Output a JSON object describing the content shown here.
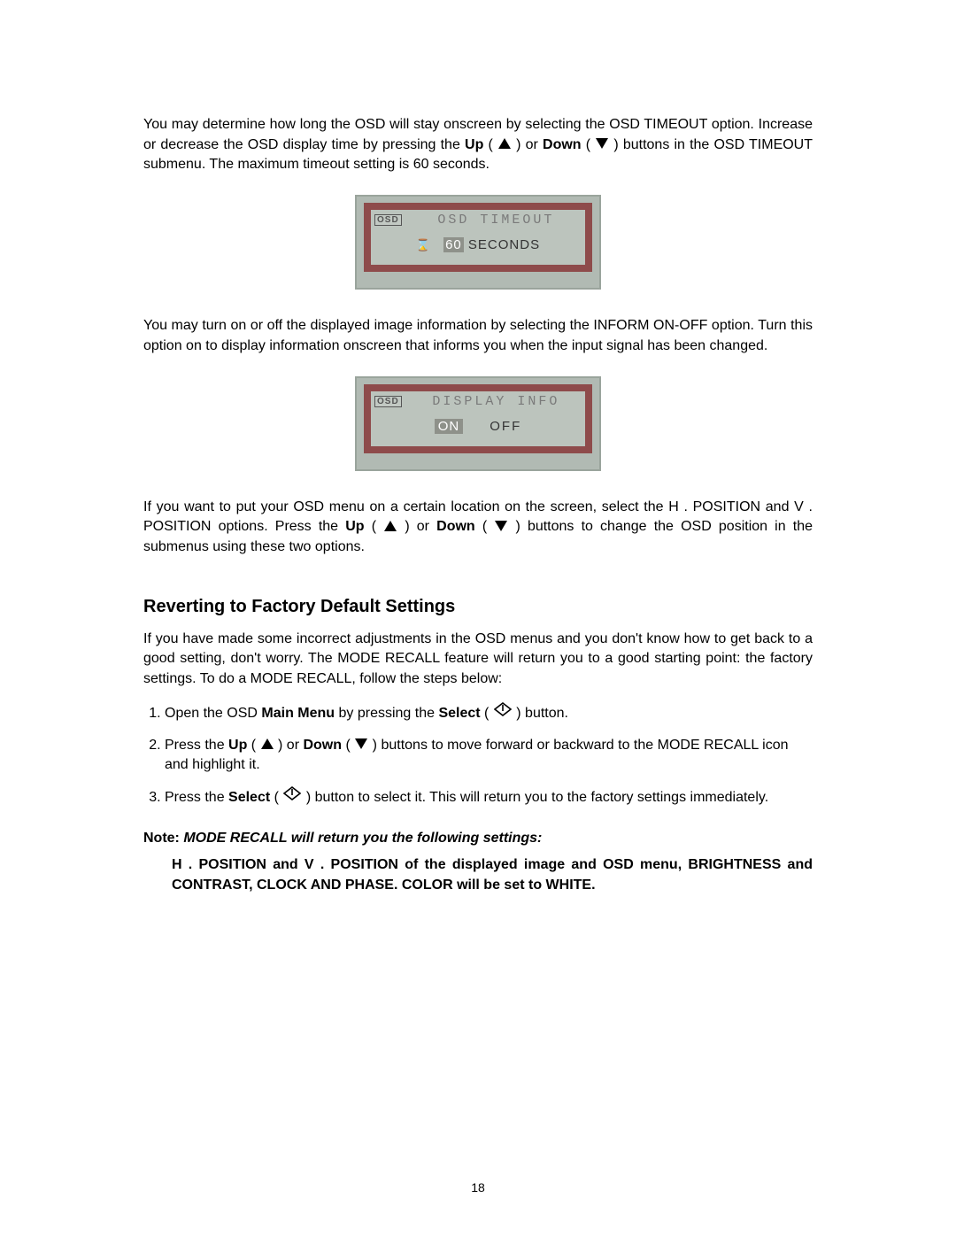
{
  "para1": {
    "a": "You may determine how long the OSD will stay onscreen by selecting the OSD TIMEOUT option. Increase or decrease the OSD display time by pressing the ",
    "b": "Up",
    "c": " ( ",
    "d": " ) or ",
    "e": "Down",
    "f": " ( ",
    "g": " ) buttons in the OSD TIMEOUT submenu. The maximum timeout setting is 60 seconds."
  },
  "osd1": {
    "badge": "OSD",
    "title": "OSD TIMEOUT",
    "value_hl": "60",
    "value_unit": "SECONDS"
  },
  "para2": "You may turn on or off the displayed image information by selecting the INFORM ON-OFF option. Turn this option on to display information onscreen that informs you when the input signal has been changed.",
  "osd2": {
    "badge": "OSD",
    "title": "DISPLAY INFO",
    "on": "ON",
    "off": "OFF"
  },
  "para3": {
    "a": "If you want to put your OSD menu on a certain location on the screen, select the H . POSITION and V . POSITION options. Press the ",
    "b": "Up",
    "c": " ( ",
    "d": " ) or ",
    "e": "Down",
    "f": " ( ",
    "g": " ) buttons to change the OSD position in the submenus using these two options."
  },
  "heading": "Reverting to Factory Default Settings",
  "para4": "If you have made some incorrect adjustments in the OSD menus and you don't know how to get back to a good setting, don't worry. The MODE RECALL feature will return you to a good starting point: the factory settings. To do a MODE RECALL, follow the steps below:",
  "step1": {
    "a": "Open the OSD ",
    "b": "Main Menu",
    "c": " by pressing the ",
    "d": "Select",
    "e": " ( ",
    "f": " ) button."
  },
  "step2": {
    "a": "Press the ",
    "b": "Up",
    "c": " ( ",
    "d": " ) or ",
    "e": "Down",
    "f": " ( ",
    "g": " ) buttons to move forward or backward to the MODE RECALL icon and highlight it."
  },
  "step3": {
    "a": "Press the ",
    "b": "Select",
    "c": " ( ",
    "d": " ) button to select it. This will return you to the factory settings immediately."
  },
  "note": {
    "prefix": "Note: ",
    "ital": "MODE RECALL will return you the following settings:",
    "body": "H . POSITION and V . POSITION of the displayed image and OSD menu, BRIGHTNESS and CONTRAST, CLOCK AND PHASE. COLOR will be set to WHITE."
  },
  "page_number": "18"
}
